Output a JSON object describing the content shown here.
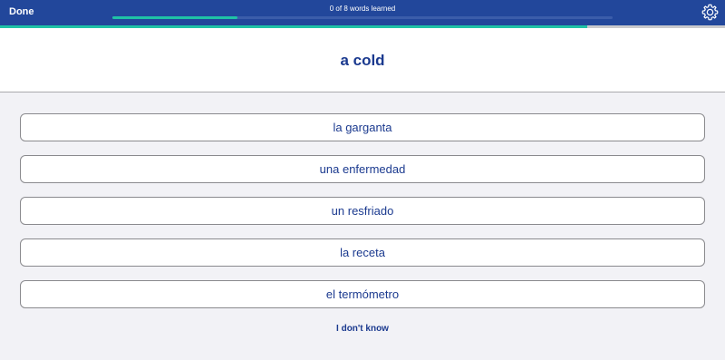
{
  "header": {
    "done_label": "Done",
    "progress_text": "0 of 8 words learned",
    "progress_fraction": 0.25,
    "settings_icon": "gear-icon"
  },
  "session_progress_fraction": 0.81,
  "prompt": {
    "word": "a cold"
  },
  "choices": [
    {
      "label": "la garganta"
    },
    {
      "label": "una enfermedad"
    },
    {
      "label": "un resfriado"
    },
    {
      "label": "la receta"
    },
    {
      "label": "el termómetro"
    }
  ],
  "dont_know_label": "I don't know",
  "colors": {
    "header_bg": "#22479b",
    "accent": "#1fc3a6",
    "text_primary": "#1b3a8f",
    "page_bg": "#f2f2f6"
  }
}
